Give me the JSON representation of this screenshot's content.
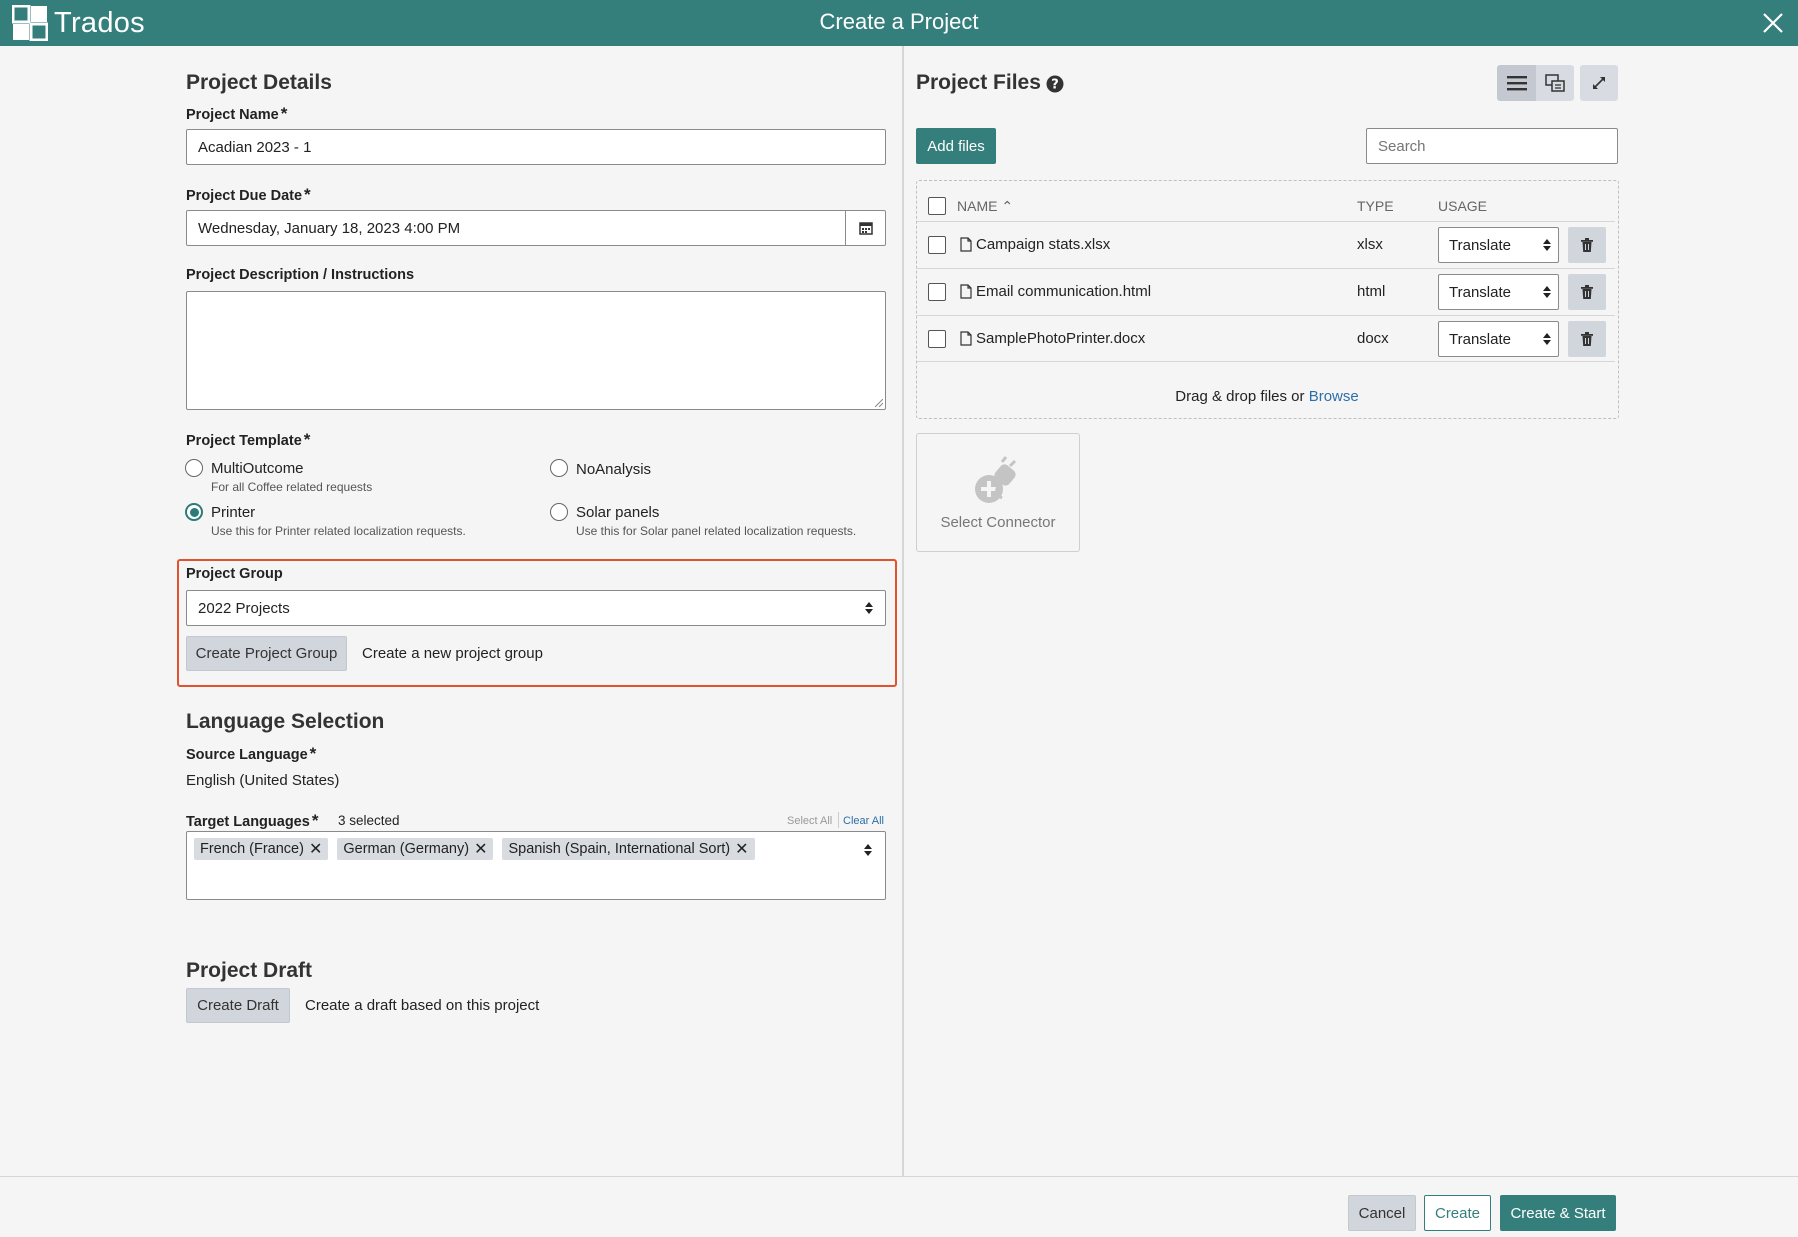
{
  "app": {
    "logo_text": "Trados",
    "dialog_title": "Create a Project",
    "icons": {
      "close": "close-icon",
      "logo": "trados-logo-icon"
    }
  },
  "details": {
    "heading": "Project Details",
    "name_label": "Project Name",
    "name_value": "Acadian 2023 - 1",
    "due_label": "Project Due Date",
    "due_value": "Wednesday, January 18, 2023 4:00 PM",
    "desc_label": "Project Description / Instructions",
    "desc_value": "",
    "required_mark": "*"
  },
  "template": {
    "label": "Project Template",
    "options": [
      {
        "name": "MultiOutcome",
        "desc": "For all Coffee related requests",
        "selected": false
      },
      {
        "name": "NoAnalysis",
        "desc": "",
        "selected": false
      },
      {
        "name": "Printer",
        "desc": "Use this for Printer related localization requests.",
        "selected": true
      },
      {
        "name": "Solar panels",
        "desc": "Use this for Solar panel related localization requests.",
        "selected": false
      }
    ]
  },
  "group": {
    "label": "Project Group",
    "selected": "2022 Projects",
    "create_button": "Create Project Group",
    "create_hint": "Create a new project group",
    "highlight_color": "#e0532f"
  },
  "language": {
    "heading": "Language Selection",
    "source_label": "Source Language",
    "source_value": "English (United States)",
    "target_label": "Target Languages",
    "selected_count": "3 selected",
    "select_all": "Select All",
    "clear_all": "Clear All",
    "targets": [
      "French (France)",
      "German (Germany)",
      "Spanish (Spain, International Sort)"
    ]
  },
  "draft": {
    "heading": "Project Draft",
    "button": "Create Draft",
    "hint": "Create a draft based on this project"
  },
  "files": {
    "heading": "Project Files",
    "add_button": "Add files",
    "search_placeholder": "Search",
    "columns": {
      "name": "NAME",
      "type": "TYPE",
      "usage": "USAGE"
    },
    "rows": [
      {
        "name": "Campaign stats.xlsx",
        "type": "xlsx",
        "usage": "Translate"
      },
      {
        "name": "Email communication.html",
        "type": "html",
        "usage": "Translate"
      },
      {
        "name": "SamplePhotoPrinter.docx",
        "type": "docx",
        "usage": "Translate"
      }
    ],
    "drop_text": "Drag & drop files or",
    "browse": "Browse",
    "connector_label": "Select Connector"
  },
  "footer": {
    "cancel": "Cancel",
    "create": "Create",
    "create_start": "Create & Start"
  },
  "colors": {
    "teal": "#347f7c",
    "link": "#2c6fa8"
  }
}
